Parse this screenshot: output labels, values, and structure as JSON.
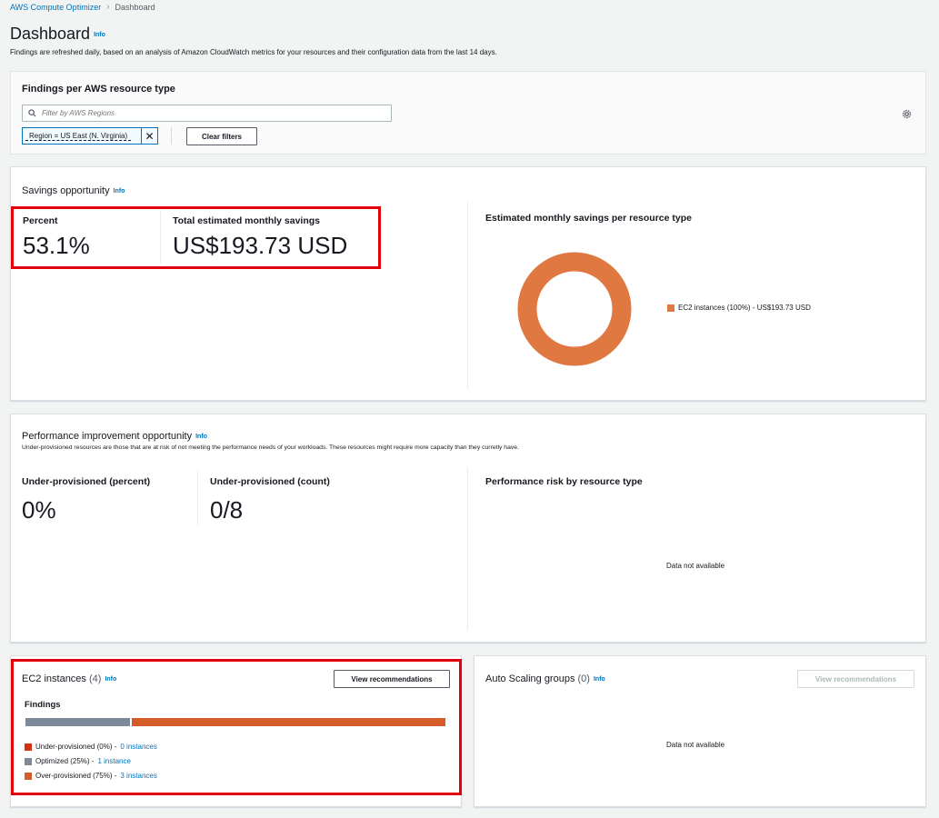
{
  "breadcrumb": {
    "root": "AWS Compute Optimizer",
    "current": "Dashboard"
  },
  "page": {
    "title": "Dashboard",
    "info": "Info",
    "subtitle": "Findings are refreshed daily, based on an analysis of Amazon CloudWatch metrics for your resources and their configuration data from the last 14 days."
  },
  "filter_panel": {
    "title": "Findings per AWS resource type",
    "search_placeholder": "Filter by AWS Regions",
    "token": "Region = US East (N. Virginia)",
    "clear_label": "Clear filters",
    "settings_icon": "gear-icon"
  },
  "savings": {
    "title": "Savings opportunity",
    "info": "Info",
    "percent_label": "Percent",
    "percent_value": "53.1%",
    "total_label": "Total estimated monthly savings",
    "total_value": "US$193.73 USD",
    "chart_title": "Estimated monthly savings per resource type",
    "legend_item": "EC2 instances (100%) - US$193.73 USD",
    "donut_color": "#e07941"
  },
  "performance": {
    "title": "Performance improvement opportunity",
    "info": "Info",
    "description": "Under-provisioned resources are those that are at risk of not meeting the performance needs of your workloads. These resources might require more capacity than they curretly have.",
    "under_percent_label": "Under-provisioned (percent)",
    "under_percent_value": "0%",
    "under_count_label": "Under-provisioned (count)",
    "under_count_value": "0/8",
    "risk_title": "Performance risk by resource type",
    "risk_empty": "Data not available"
  },
  "ec2": {
    "title": "EC2 instances",
    "count": "(4)",
    "info": "Info",
    "button": "View recommendations",
    "findings_label": "Findings",
    "bar": [
      {
        "name": "Optimized",
        "fraction": 0.25,
        "color": "#7d8998"
      },
      {
        "name": "Over-provisioned",
        "fraction": 0.75,
        "color": "#d45b2a"
      }
    ],
    "legend": [
      {
        "text": "Under-provisioned (0%) - ",
        "link": "0 instances",
        "color": "#d13212"
      },
      {
        "text": "Optimized (25%) - ",
        "link": "1 instance",
        "color": "#7d8998"
      },
      {
        "text": "Over-provisioned (75%) - ",
        "link": "3 instances",
        "color": "#d45b2a"
      }
    ]
  },
  "asg": {
    "title": "Auto Scaling groups",
    "count": "(0)",
    "info": "Info",
    "button": "View recommendations",
    "empty": "Data not available"
  }
}
